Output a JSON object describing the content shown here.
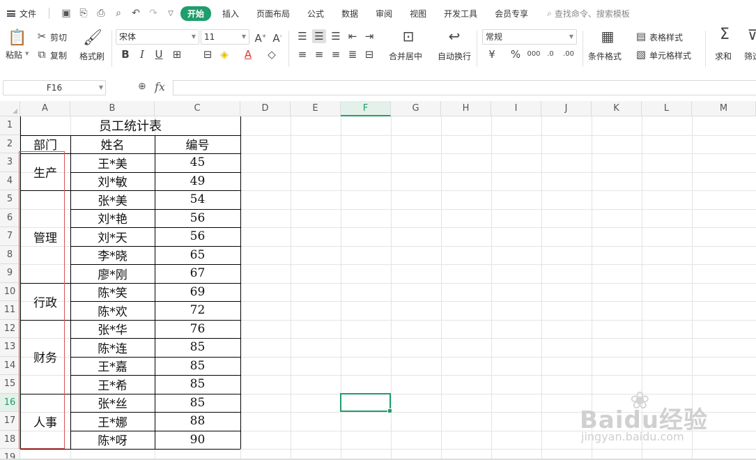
{
  "menu": {
    "file": "文件",
    "start": "开始",
    "tabs": [
      "插入",
      "页面布局",
      "公式",
      "数据",
      "审阅",
      "视图",
      "开发工具",
      "会员专享"
    ],
    "search_placeholder": "查找命令、搜索模板"
  },
  "ribbon": {
    "paste": "粘贴",
    "cut": "剪切",
    "copy": "复制",
    "format_painter": "格式刷",
    "font_name": "宋体",
    "font_size": "11",
    "merge_center": "合并居中",
    "wrap_text": "自动换行",
    "number_format": "常规",
    "conditional_format": "条件格式",
    "table_style": "表格样式",
    "cell_style": "单元格样式",
    "sum": "求和",
    "filter": "筛选"
  },
  "formula_bar": {
    "name_box": "F16",
    "fx_label": "fx",
    "formula": ""
  },
  "columns": [
    "A",
    "B",
    "C",
    "D",
    "E",
    "F",
    "G",
    "H",
    "I",
    "J",
    "K",
    "L",
    "M"
  ],
  "rows": [
    "1",
    "2",
    "3",
    "4",
    "5",
    "6",
    "7",
    "8",
    "9",
    "10",
    "11",
    "12",
    "13",
    "14",
    "15",
    "16",
    "17",
    "18",
    "19"
  ],
  "active_cell": "F16",
  "sheet": {
    "title": "员工统计表",
    "headers": [
      "部门",
      "姓名",
      "编号"
    ],
    "departments": [
      "生产",
      "管理",
      "行政",
      "财务",
      "人事"
    ],
    "names": [
      "王*美",
      "刘*敏",
      "张*美",
      "刘*艳",
      "刘*天",
      "李*晓",
      "廖*刚",
      "陈*笑",
      "陈*欢",
      "张*华",
      "陈*连",
      "王*嘉",
      "王*希",
      "张*丝",
      "王*娜",
      "陈*呀"
    ],
    "numbers": [
      "45",
      "49",
      "54",
      "56",
      "56",
      "65",
      "67",
      "69",
      "72",
      "76",
      "85",
      "85",
      "85",
      "85",
      "88",
      "90"
    ]
  },
  "watermark": {
    "logo": "Baidu经验",
    "url": "jingyan.baidu.com"
  },
  "colors": {
    "accent": "#1f9d6b",
    "highlight_box": "#d9534f"
  }
}
